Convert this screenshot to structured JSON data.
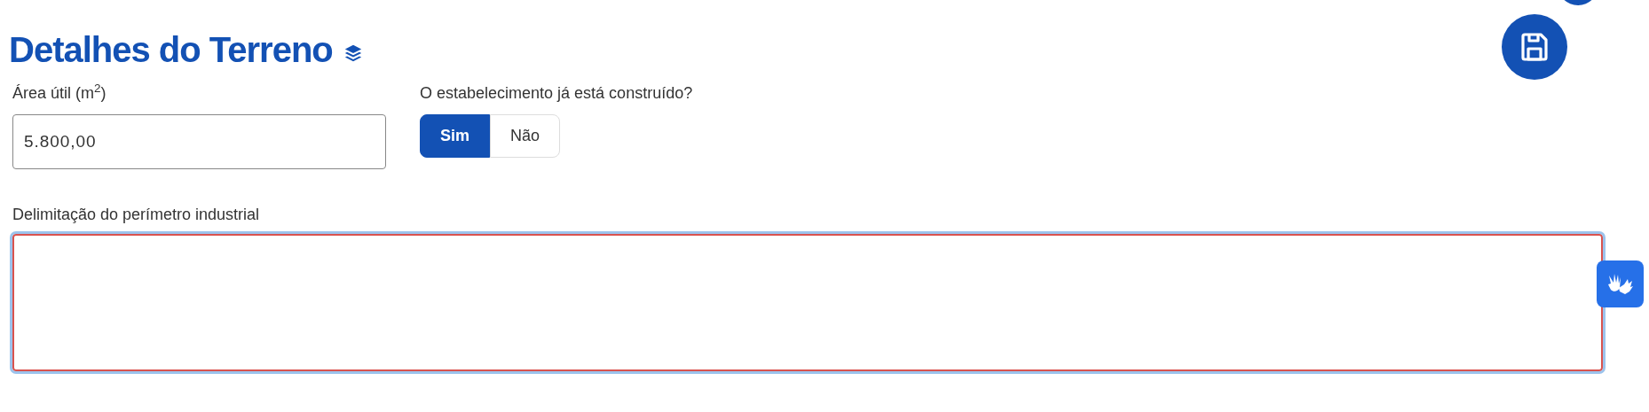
{
  "title": "Detalhes do Terreno",
  "area_field": {
    "label": "Área útil (m$^{2}$)",
    "value": "5.800,00"
  },
  "built_question": {
    "label": "O estabelecimento já está construído?",
    "options": [
      {
        "label": "Sim",
        "selected": true
      },
      {
        "label": "Não",
        "selected": false
      }
    ]
  },
  "perimeter_field": {
    "label": "Delimitação do perímetro industrial"
  }
}
